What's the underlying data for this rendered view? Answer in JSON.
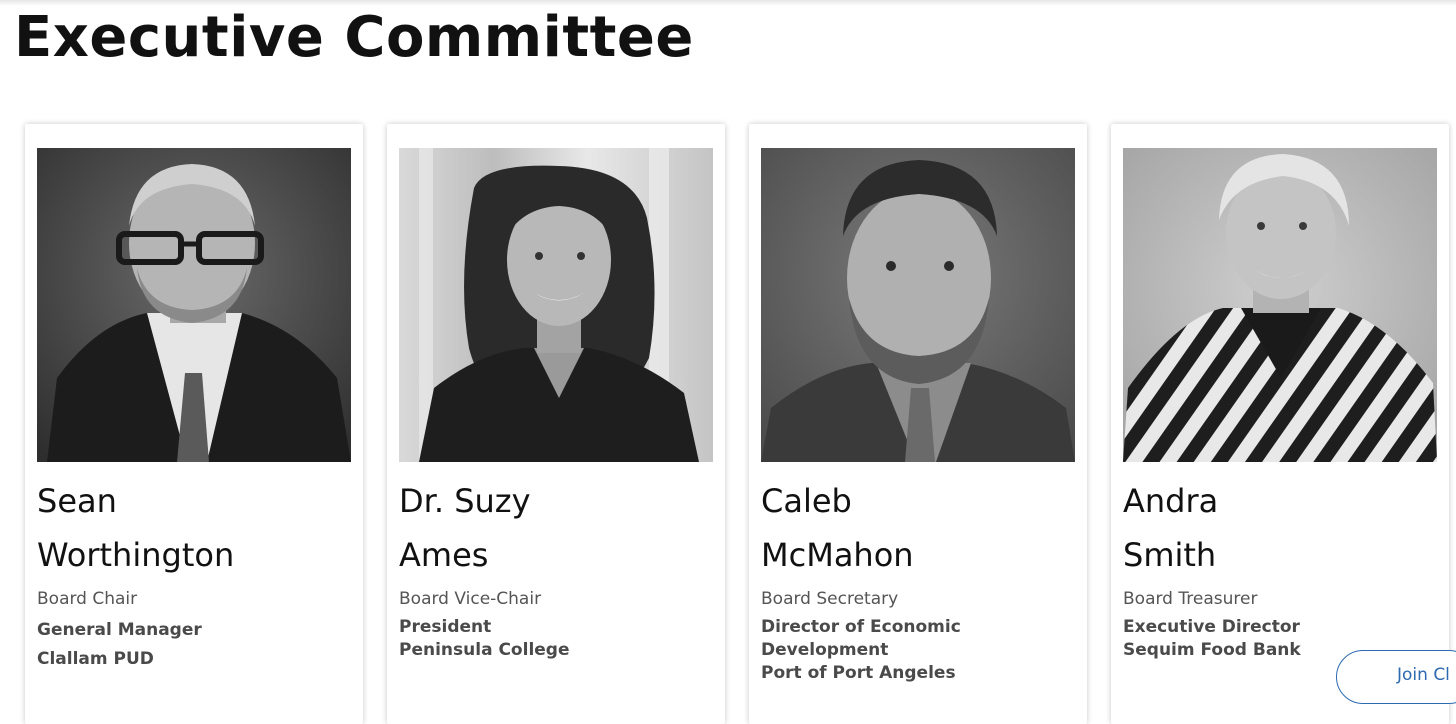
{
  "page": {
    "title": "Executive Committee"
  },
  "members": [
    {
      "name_first": "Sean",
      "name_last": "Worthington",
      "role": "Board Chair",
      "org_lines": [
        "General Manager",
        "Clallam PUD"
      ]
    },
    {
      "name_first": "Dr. Suzy",
      "name_last": "Ames",
      "role": "Board Vice-Chair",
      "org_lines": [
        "President",
        "Peninsula College"
      ]
    },
    {
      "name_first": "Caleb",
      "name_last": "McMahon",
      "role": "Board Secretary",
      "org_lines": [
        "Director of Economic",
        "Development",
        "Port of Port Angeles"
      ]
    },
    {
      "name_first": "Andra",
      "name_last": "Smith",
      "role": "Board Treasurer",
      "org_lines": [
        "Executive Director",
        "Sequim Food Bank"
      ]
    }
  ],
  "join_button": {
    "label": "Join Cl"
  },
  "colors": {
    "accent": "#2d6ab0",
    "title": "#111111",
    "role_text": "#555555",
    "org_text": "#4a4a4a"
  }
}
